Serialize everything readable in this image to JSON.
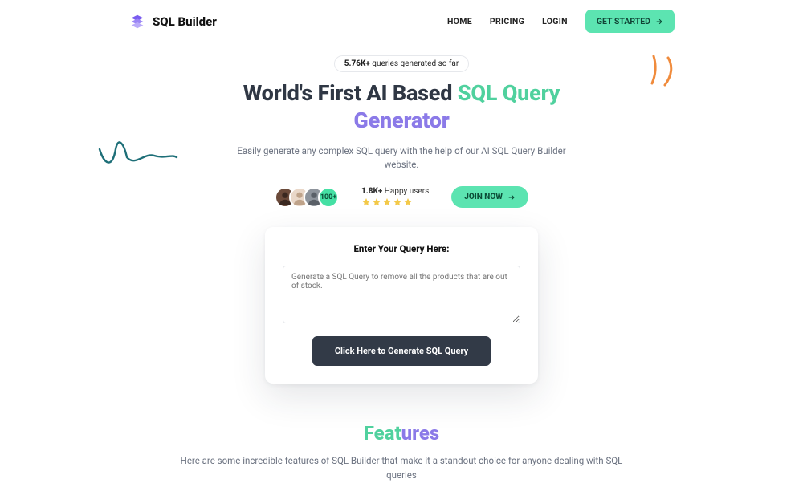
{
  "brand": {
    "name": "SQL Builder"
  },
  "nav": {
    "home": "HOME",
    "pricing": "PRICING",
    "login": "LOGIN",
    "cta": "GET STARTED"
  },
  "hero": {
    "pill_bold": "5.76K+",
    "pill_rest": " queries generated so far",
    "h1_a": "World's First AI Based ",
    "h1_b": "SQL Query",
    "h1_c": "Generator",
    "sub": "Easily generate any complex SQL query with the help of our AI SQL Query Builder website.",
    "avatars_more": "100+",
    "happy_bold": "1.8K+",
    "happy_rest": " Happy users",
    "join": "JOIN NOW"
  },
  "card": {
    "title": "Enter Your Query Here:",
    "placeholder": "Generate a SQL Query to remove all the products that are out of stock.",
    "button": "Click Here to Generate SQL Query"
  },
  "features": {
    "h2_a": "Feat",
    "h2_b": "ures",
    "sub": "Here are some incredible features of SQL Builder that make it a standout choice for anyone dealing with SQL queries"
  }
}
